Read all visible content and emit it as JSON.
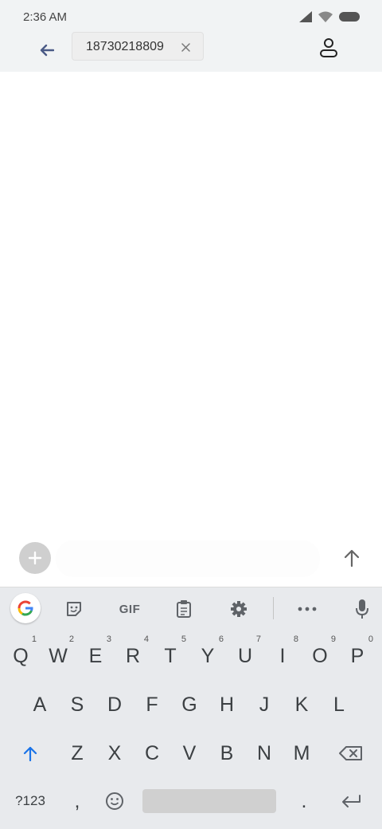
{
  "status_bar": {
    "time": "2:36 AM"
  },
  "header": {
    "recipient": "18730218809"
  },
  "compose": {
    "placeholder": ""
  },
  "keyboard": {
    "toolbar": {
      "gif_label": "GIF"
    },
    "row1": [
      {
        "label": "Q",
        "hint": "1"
      },
      {
        "label": "W",
        "hint": "2"
      },
      {
        "label": "E",
        "hint": "3"
      },
      {
        "label": "R",
        "hint": "4"
      },
      {
        "label": "T",
        "hint": "5"
      },
      {
        "label": "Y",
        "hint": "6"
      },
      {
        "label": "U",
        "hint": "7"
      },
      {
        "label": "I",
        "hint": "8"
      },
      {
        "label": "O",
        "hint": "9"
      },
      {
        "label": "P",
        "hint": "0"
      }
    ],
    "row2": [
      "A",
      "S",
      "D",
      "F",
      "G",
      "H",
      "J",
      "K",
      "L"
    ],
    "row3": [
      "Z",
      "X",
      "C",
      "V",
      "B",
      "N",
      "M"
    ],
    "row4": {
      "symbols": "?123",
      "comma": ",",
      "period": "."
    }
  },
  "colors": {
    "bar_bg": "#f1f3f4",
    "keyboard_bg": "#e8eaed",
    "shift_blue": "#1a73e8",
    "back_arrow": "#4a5a86"
  }
}
